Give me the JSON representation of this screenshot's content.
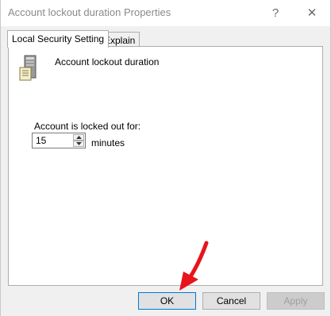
{
  "window": {
    "title": "Account lockout duration Properties",
    "help_glyph": "?",
    "close_glyph": "✕"
  },
  "tabs": [
    {
      "label": "Local Security Setting",
      "active": true
    },
    {
      "label": "Explain",
      "active": false
    }
  ],
  "setting": {
    "icon": "server-icon",
    "policy_name": "Account lockout duration",
    "locked_out_label": "Account is locked out for:",
    "duration_value": "15",
    "unit": "minutes"
  },
  "buttons": {
    "ok": "OK",
    "cancel": "Cancel",
    "apply": "Apply"
  },
  "annotation": {
    "arrow_color": "#e8141c"
  }
}
